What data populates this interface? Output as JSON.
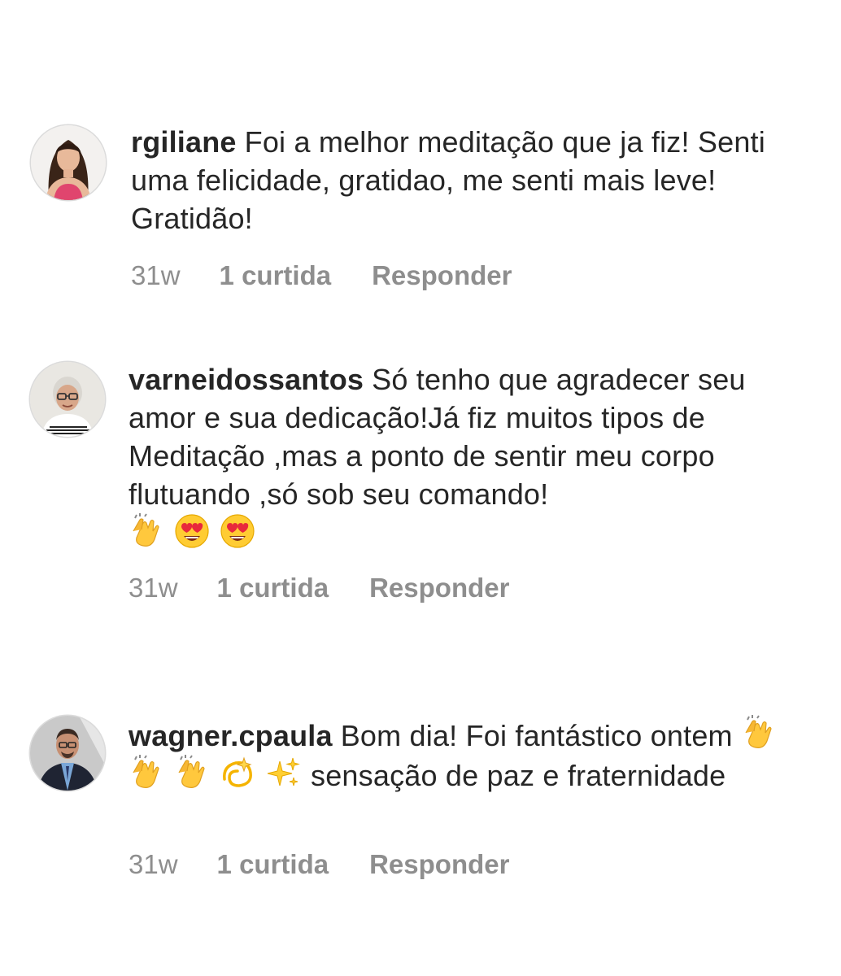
{
  "comments": [
    {
      "username": "rgiliane",
      "text": "Foi a melhor meditação que ja fiz! Senti uma felicidade, gratidao, me senti mais leve! Gratidão!",
      "emojis": [],
      "text_after_emojis": "",
      "time": "31w",
      "likes": "1 curtida",
      "reply": "Responder",
      "avatar_icon": "woman-dark-hair-pink-top-avatar"
    },
    {
      "username": "varneidossantos",
      "text": "Só tenho que agradecer seu amor e sua dedicação!Já fiz muitos tipos de Meditação ,mas a ponto de sentir meu corpo flutuando ,só sob seu comando!",
      "emojis": [
        "clapping-hands-emoji",
        "heart-eyes-emoji",
        "heart-eyes-emoji"
      ],
      "text_after_emojis": "",
      "time": "31w",
      "likes": "1 curtida",
      "reply": "Responder",
      "avatar_icon": "older-woman-glasses-avatar"
    },
    {
      "username": "wagner.cpaula",
      "text": "Bom dia! Foi fantástico ontem",
      "emojis": [
        "clapping-hands-emoji",
        "clapping-hands-emoji",
        "clapping-hands-emoji",
        "dizzy-emoji",
        "sparkles-emoji"
      ],
      "text_after_emojis": "sensação de paz e fraternidade",
      "time": "31w",
      "likes": "1 curtida",
      "reply": "Responder",
      "avatar_icon": "man-suit-glasses-avatar"
    }
  ],
  "colors": {
    "text": "#262626",
    "meta": "#8e8e8e",
    "avatar_ring": "#dbdbdb"
  }
}
